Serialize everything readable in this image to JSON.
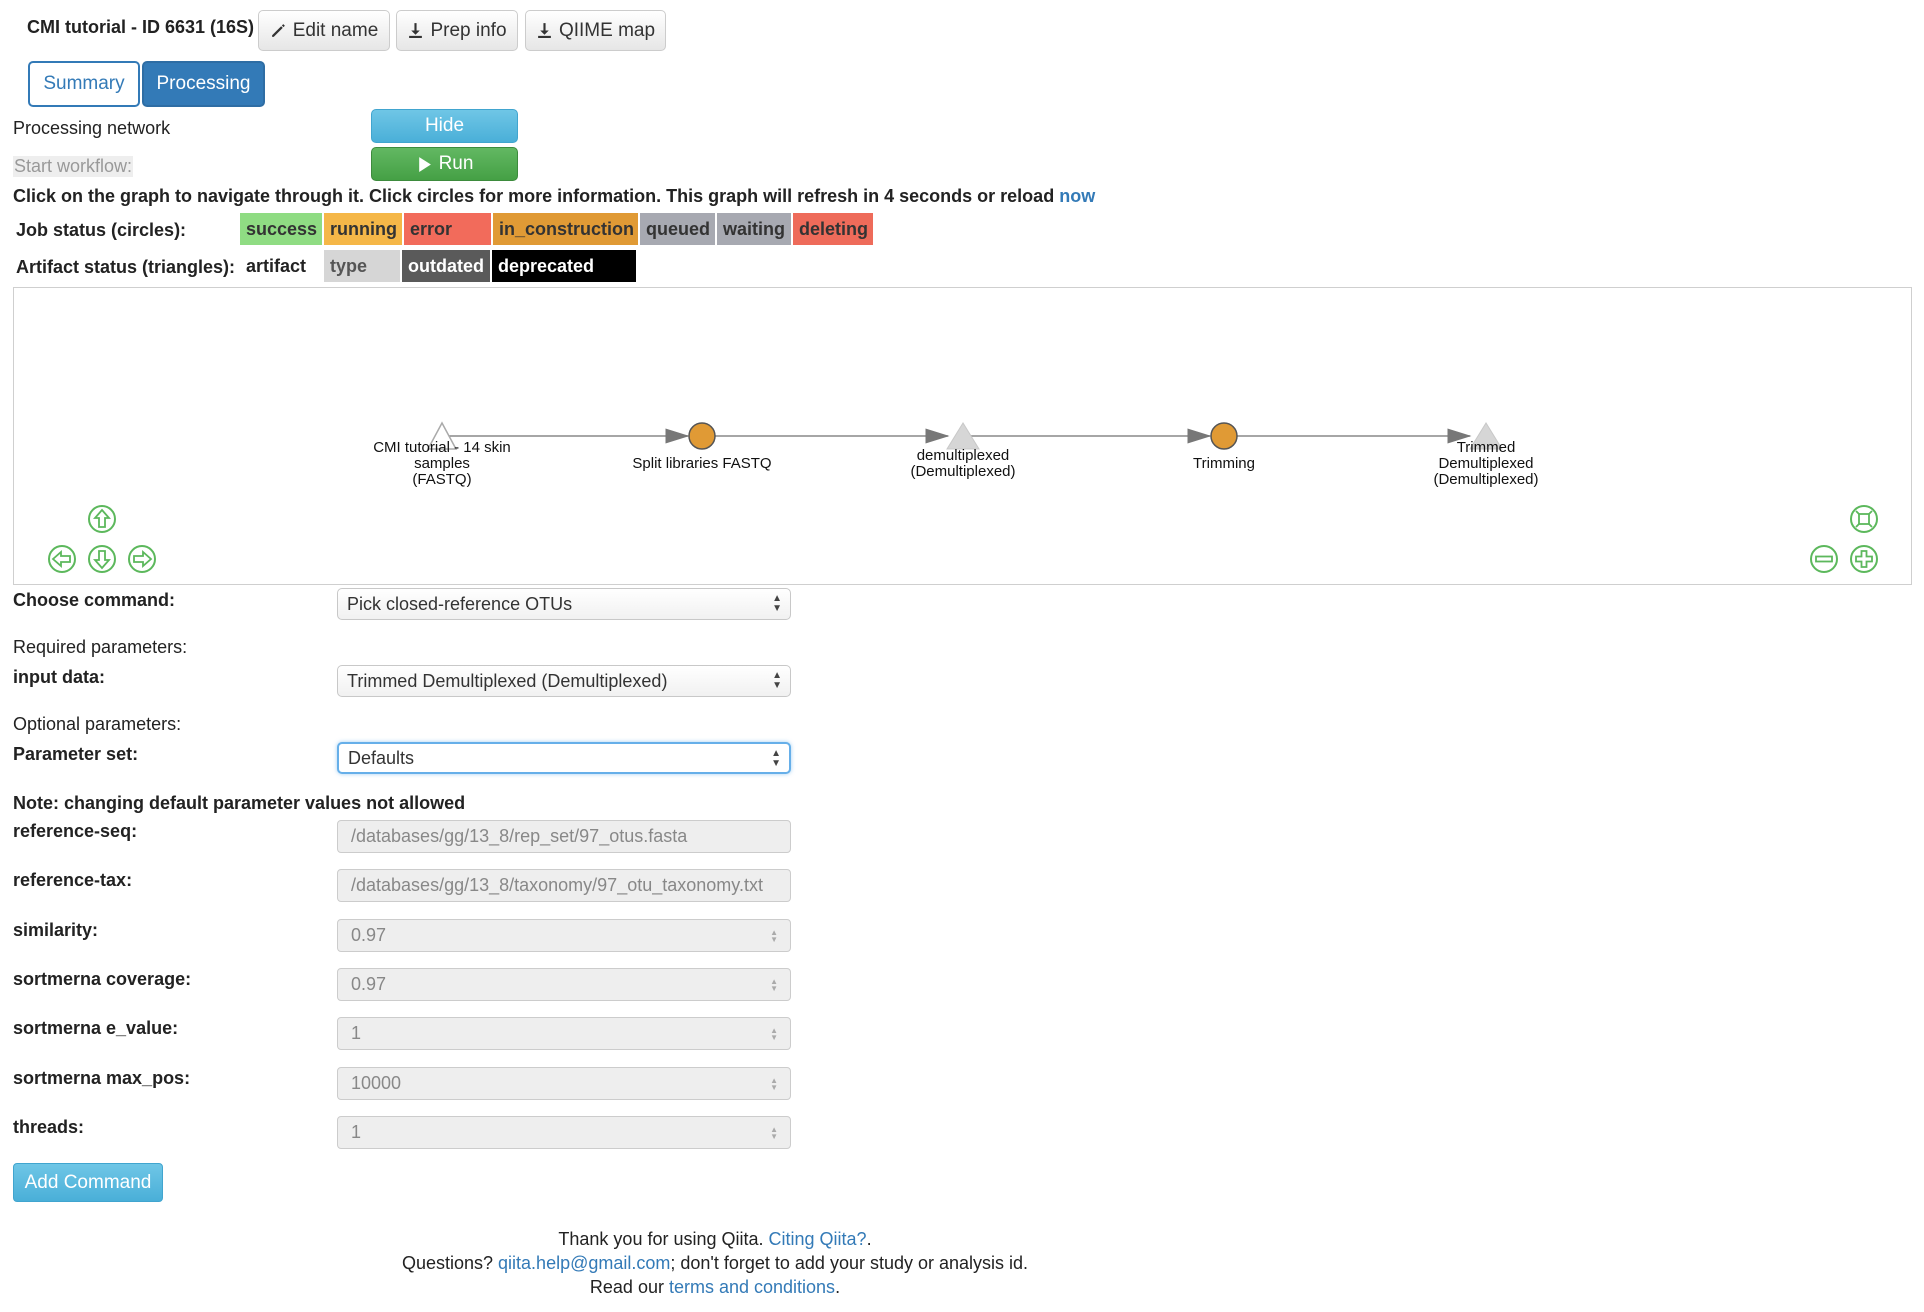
{
  "header": {
    "title": "CMI tutorial - ID 6631 (16S)",
    "edit_name": "Edit name",
    "prep_info": "Prep info",
    "qiime_map": "QIIME map"
  },
  "tabs": {
    "summary": "Summary",
    "processing": "Processing"
  },
  "processing": {
    "network_label": "Processing network",
    "hide_button": "Hide",
    "start_workflow": "Start workflow:",
    "run_button": "Run",
    "instructions": "Click on the graph to navigate through it. Click circles for more information. This graph will refresh in 4 seconds or reload ",
    "now_link": "now"
  },
  "legend": {
    "job_label": "Job status (circles):",
    "job_statuses": [
      {
        "label": "success",
        "color": "#8fdc83"
      },
      {
        "label": "running",
        "color": "#f5b748"
      },
      {
        "label": "error",
        "color": "#f26b5b"
      },
      {
        "label": "in_construction",
        "color": "#e09a35"
      },
      {
        "label": "queued",
        "color": "#a7a9b1"
      },
      {
        "label": "waiting",
        "color": "#a7a9b1"
      },
      {
        "label": "deleting",
        "color": "#ee6b5a"
      }
    ],
    "artifact_label": "Artifact status (triangles):",
    "artifact_statuses": [
      {
        "label": "artifact",
        "color": "#ffffff",
        "text": "#222"
      },
      {
        "label": "type",
        "color": "#d6d6d6",
        "text": "#555"
      },
      {
        "label": "outdated",
        "color": "#5a5a5a",
        "text": "#ffffff"
      },
      {
        "label": "deprecated",
        "color": "#000000",
        "text": "#ffffff"
      }
    ]
  },
  "graph": {
    "nodes": [
      {
        "kind": "artifact",
        "label1": "CMI tutorial - 14 skin",
        "label2": "samples",
        "label3": "(FASTQ)"
      },
      {
        "kind": "job",
        "label1": "Split libraries FASTQ",
        "color": "#e09a35"
      },
      {
        "kind": "artifact",
        "label1": "demultiplexed",
        "label2": "(Demultiplexed)"
      },
      {
        "kind": "job",
        "label1": "Trimming",
        "color": "#e09a35"
      },
      {
        "kind": "artifact",
        "label1": "Trimmed",
        "label2": "Demultiplexed",
        "label3": "(Demultiplexed)"
      }
    ],
    "nav_color": "#5cb85c"
  },
  "form": {
    "choose_command_label": "Choose command:",
    "choose_command_value": "Pick closed-reference OTUs",
    "required_label": "Required parameters:",
    "input_data_label": "input data:",
    "input_data_value": "Trimmed Demultiplexed (Demultiplexed)",
    "optional_label": "Optional parameters:",
    "parameter_set_label": "Parameter set:",
    "parameter_set_value": "Defaults",
    "note": "Note: changing default parameter values not allowed",
    "params": [
      {
        "label": "reference-seq:",
        "value": "/databases/gg/13_8/rep_set/97_otus.fasta",
        "numeric": false
      },
      {
        "label": "reference-tax:",
        "value": "/databases/gg/13_8/taxonomy/97_otu_taxonomy.txt",
        "numeric": false
      },
      {
        "label": "similarity:",
        "value": "0.97",
        "numeric": true
      },
      {
        "label": "sortmerna coverage:",
        "value": "0.97",
        "numeric": true
      },
      {
        "label": "sortmerna e_value:",
        "value": "1",
        "numeric": true
      },
      {
        "label": "sortmerna max_pos:",
        "value": "10000",
        "numeric": true
      },
      {
        "label": "threads:",
        "value": "1",
        "numeric": true
      }
    ],
    "add_command": "Add Command"
  },
  "footer": {
    "line1_prefix": "Thank you for using Qiita. ",
    "line1_link": "Citing Qiita?",
    "line1_suffix": ".",
    "line2_prefix": "Questions? ",
    "line2_link": "qiita.help@gmail.com",
    "line2_suffix": "; don't forget to add your study or analysis id.",
    "line3_prefix": "Read our ",
    "line3_link": "terms and conditions",
    "line3_suffix": "."
  }
}
